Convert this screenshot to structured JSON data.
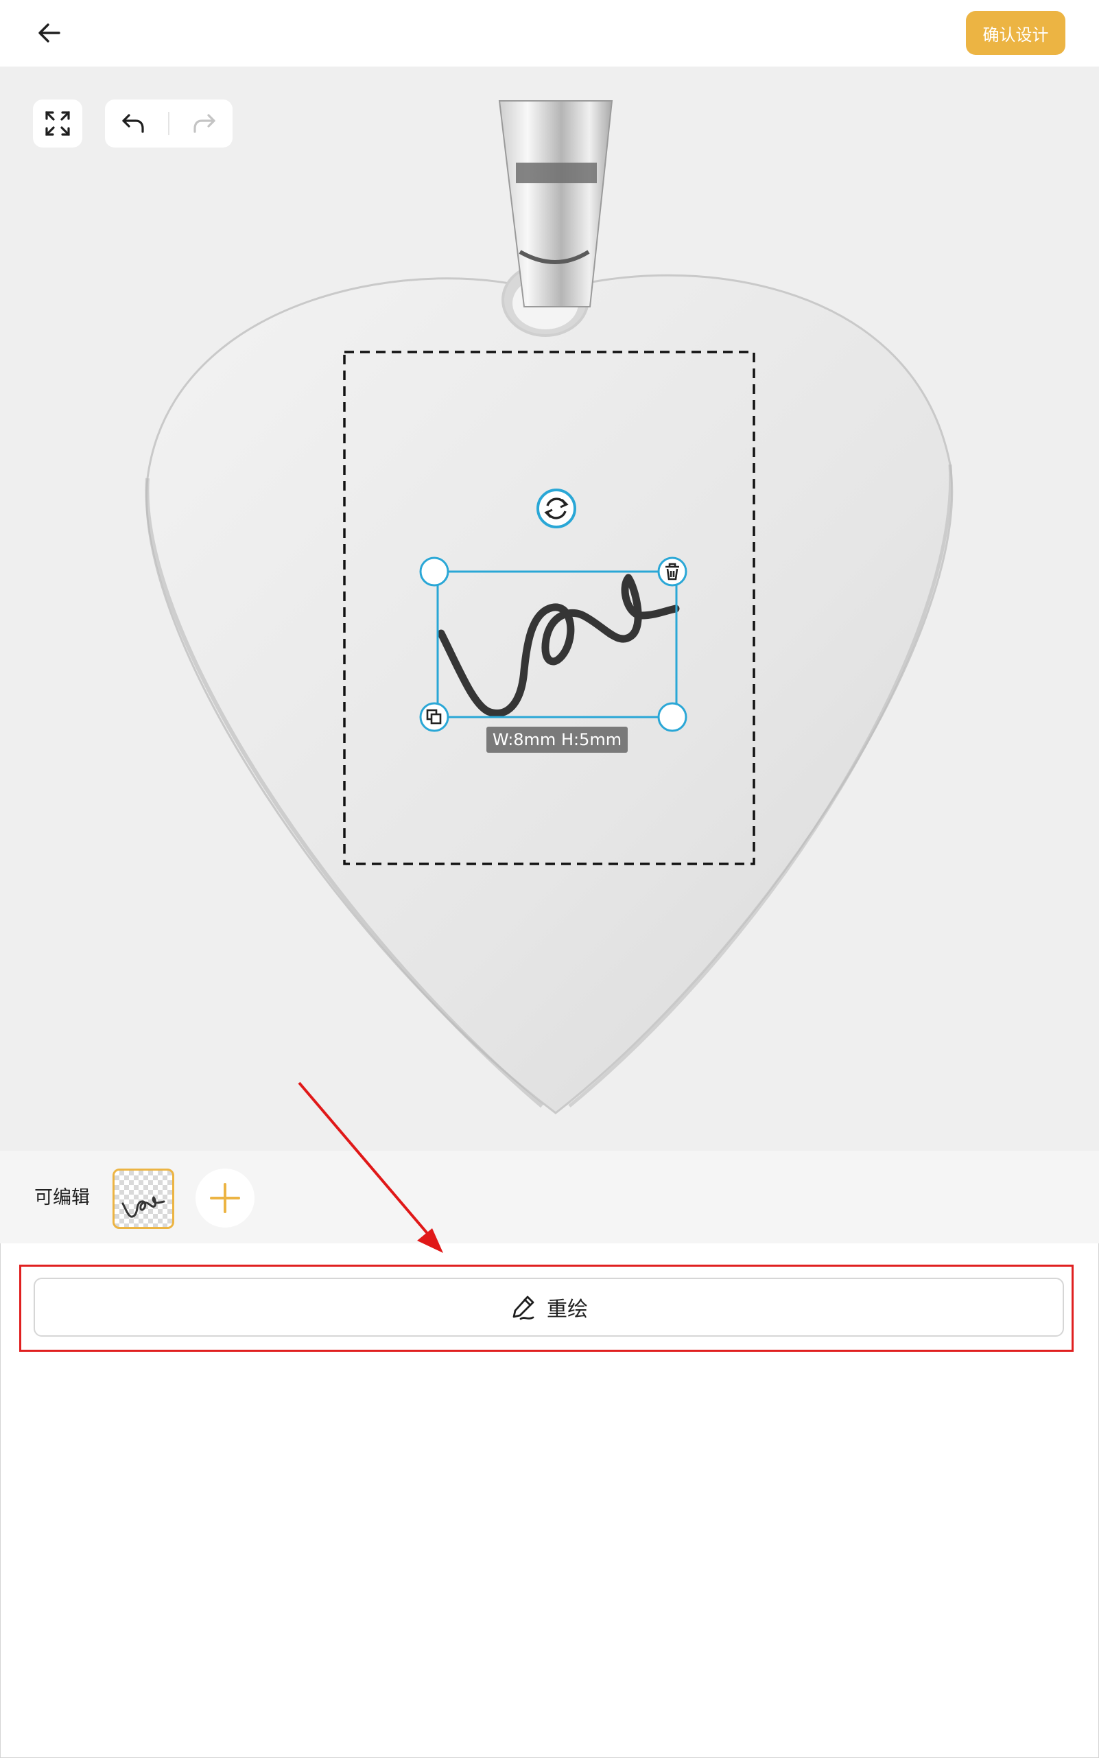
{
  "header": {
    "back_icon": "arrow-left-icon",
    "confirm_label": "确认设计",
    "accent_color": "#ecb443"
  },
  "canvas_toolbar": {
    "fit_icon": "expand-icon",
    "undo_icon": "undo-icon",
    "redo_icon": "redo-icon",
    "redo_enabled": false
  },
  "selection": {
    "size_label": "W:8mm H:5mm",
    "rotate_icon": "rotate-icon",
    "delete_icon": "trash-icon",
    "duplicate_icon": "copy-icon",
    "handle_color": "#2aa7d6"
  },
  "layers": {
    "label": "可编辑",
    "add_icon": "plus-icon"
  },
  "redraw": {
    "label": "重绘",
    "icon": "pencil-icon"
  }
}
